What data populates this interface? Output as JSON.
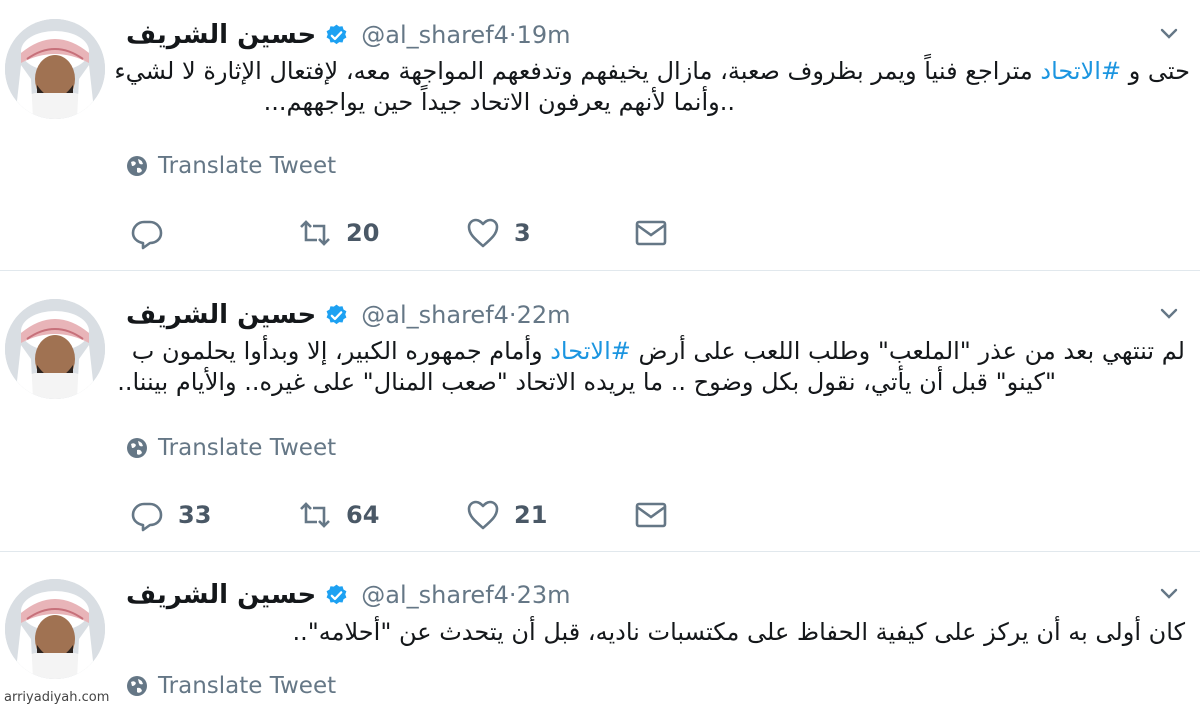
{
  "tweets": [
    {
      "name": "حسين الشريف",
      "handle": "@al_sharef4",
      "time": "19m",
      "text_lines": [
        {
          "before": "حتى و ",
          "hashtag": "#الاتحاد",
          "after": " متراجع فنياً ويمر بظروف صعبة، مازال يخيفهم وتدفعهم المواجهة معه، لإفتعال الإثارة لا لشيء"
        },
        {
          "before": "..وأنما لأنهم يعرفون الاتحاد جيداً حين يواجههم...",
          "hashtag": "",
          "after": ""
        }
      ],
      "translate": "Translate Tweet",
      "replies": "",
      "retweets": "20",
      "likes": "3"
    },
    {
      "name": "حسين الشريف",
      "handle": "@al_sharef4",
      "time": "22m",
      "text_lines": [
        {
          "before": "لم تنتهي بعد من عذر \"الملعب\" وطلب اللعب على أرض ",
          "hashtag": "#الاتحاد",
          "after": " وأمام جمهوره الكبير، إلا وبدأوا يحلمون  ب"
        },
        {
          "before": "\"كينو\" قبل أن يأتي، نقول بكل وضوح .. ما يريده الاتحاد \"صعب المنال\" على غيره.. والأيام بيننا..",
          "hashtag": "",
          "after": ""
        }
      ],
      "translate": "Translate Tweet",
      "replies": "33",
      "retweets": "64",
      "likes": "21"
    },
    {
      "name": "حسين الشريف",
      "handle": "@al_sharef4",
      "time": "23m",
      "text_lines": [
        {
          "before": "كان أولى به أن يركز على كيفية الحفاظ على مكتسبات ناديه، قبل أن يتحدث عن \"أحلامه\"..",
          "hashtag": "",
          "after": ""
        }
      ],
      "translate": "Translate Tweet"
    }
  ],
  "separator": " · ",
  "watermark": "arriyadiyah.com",
  "colors": {
    "link": "#1b95e0",
    "muted": "#657786",
    "verified": "#1da1f2",
    "divider": "#e1e8ed"
  },
  "icons": [
    "verified-badge-icon",
    "caret-down-icon",
    "globe-icon",
    "reply-icon",
    "retweet-icon",
    "like-icon",
    "direct-message-icon"
  ]
}
